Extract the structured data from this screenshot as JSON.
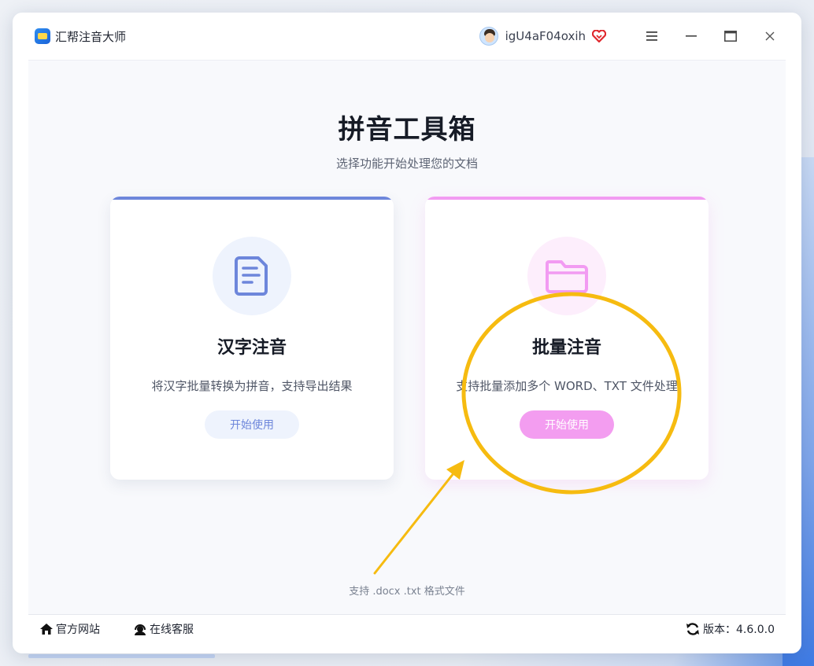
{
  "app": {
    "title": "汇帮注音大师",
    "username": "igU4aF04oxih"
  },
  "main": {
    "title": "拼音工具箱",
    "subtitle": "选择功能开始处理您的文档",
    "formats_note": "支持 .docx .txt 格式文件"
  },
  "cards": [
    {
      "title": "汉字注音",
      "description": "将汉字批量转换为拼音，支持导出结果",
      "button_label": "开始使用",
      "icon": "document-icon",
      "accent": "#6d86db"
    },
    {
      "title": "批量注音",
      "description": "支持批量添加多个 WORD、TXT 文件处理",
      "button_label": "开始使用",
      "icon": "folder-icon",
      "accent": "#f29bf2"
    }
  ],
  "footer": {
    "website_label": "官方网站",
    "support_label": "在线客服",
    "version_label": "版本：4.6.0.0"
  },
  "colors": {
    "annotation": "#f6bb10",
    "vip": "#e0282e"
  }
}
